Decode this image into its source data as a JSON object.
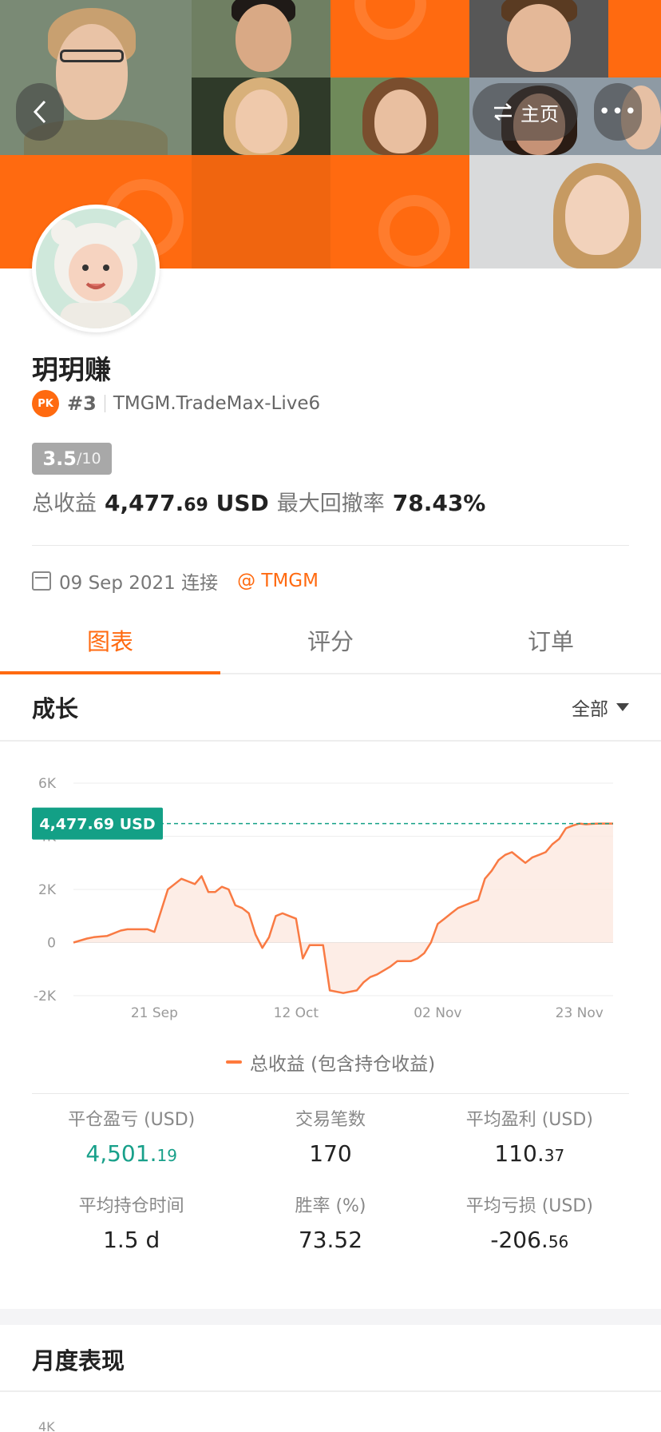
{
  "header": {
    "home_label": "主页",
    "more_label": "•••"
  },
  "profile": {
    "name": "玥玥赚",
    "pk_label": "PK",
    "rank": "#3",
    "account": "TMGM.TradeMax-Live6",
    "score": "3.5",
    "score_max": "/10",
    "total_profit_label": "总收益",
    "total_profit_int": "4,477.",
    "total_profit_dec": "69",
    "total_profit_unit": "USD",
    "max_drawdown_label": "最大回撤率",
    "max_drawdown_value": "78.43%",
    "connect_date": "09 Sep 2021 连接",
    "broker": "@ TMGM"
  },
  "tabs": [
    {
      "label": "图表",
      "active": true
    },
    {
      "label": "评分",
      "active": false
    },
    {
      "label": "订单",
      "active": false
    }
  ],
  "growth_section": {
    "title": "成长",
    "filter_label": "全部"
  },
  "chart_data": {
    "type": "area",
    "y_tick_labels": [
      "6K",
      "4K",
      "2K",
      "0",
      "-2K"
    ],
    "y_ticks": [
      6000,
      4000,
      2000,
      0,
      -2000
    ],
    "ylim": [
      -2000,
      6000
    ],
    "x_tick_labels": [
      "21 Sep",
      "12 Oct",
      "02 Nov",
      "23 Nov"
    ],
    "x_ticks_day": [
      12,
      33,
      54,
      75
    ],
    "xlim_day": [
      0,
      80
    ],
    "current_value_label": "4,477.69 USD",
    "current_value": 4477.69,
    "legend": "总收益 (包含持仓收益)",
    "line_color": "#f97a43",
    "fill_color": "#fde9e0",
    "label_color": "#13a086",
    "series": [
      {
        "name": "总收益 (包含持仓收益)",
        "x": [
          0,
          2,
          3,
          5,
          7,
          8,
          9,
          11,
          12,
          14,
          15,
          16,
          17,
          18,
          19,
          20,
          21,
          22,
          23,
          24,
          25,
          26,
          27,
          28,
          29,
          30,
          31,
          32,
          33,
          34,
          35,
          36,
          37,
          38,
          40,
          42,
          43,
          44,
          45,
          47,
          48,
          49,
          50,
          51,
          52,
          53,
          54,
          55,
          56,
          57,
          58,
          59,
          60,
          61,
          62,
          63,
          64,
          65,
          66,
          67,
          68,
          69,
          70,
          71,
          72,
          73,
          74,
          75,
          76,
          77,
          78,
          79,
          80
        ],
        "y": [
          0,
          150,
          200,
          250,
          450,
          500,
          500,
          500,
          400,
          2000,
          2200,
          2400,
          2300,
          2200,
          2500,
          1900,
          1900,
          2100,
          2000,
          1400,
          1300,
          1100,
          300,
          -200,
          200,
          1000,
          1100,
          1000,
          900,
          -600,
          -100,
          -100,
          -100,
          -1800,
          -1900,
          -1800,
          -1500,
          -1300,
          -1200,
          -900,
          -700,
          -700,
          -700,
          -600,
          -400,
          0,
          700,
          900,
          1100,
          1300,
          1400,
          1500,
          1600,
          2400,
          2700,
          3100,
          3300,
          3400,
          3200,
          3000,
          3200,
          3300,
          3400,
          3700,
          3900,
          4300,
          4400,
          4477,
          4450,
          4470,
          4477,
          4477,
          4477
        ]
      }
    ]
  },
  "stats": [
    {
      "label": "平仓盈亏 (USD)",
      "int": "4,501.",
      "dec": "19",
      "teal": true
    },
    {
      "label": "交易笔数",
      "int": "170",
      "dec": "",
      "teal": false
    },
    {
      "label": "平均盈利 (USD)",
      "int": "110.",
      "dec": "37",
      "teal": false
    },
    {
      "label": "平均持仓时间",
      "int": "1.5 d",
      "dec": "",
      "teal": false
    },
    {
      "label": "胜率 (%)",
      "int": "73.52",
      "dec": "",
      "teal": false
    },
    {
      "label": "平均亏损 (USD)",
      "int": "-206.",
      "dec": "56",
      "teal": false
    }
  ],
  "monthly": {
    "title": "月度表现",
    "axis_top": "4K"
  }
}
